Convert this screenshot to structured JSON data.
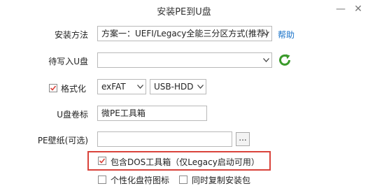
{
  "window": {
    "title": "安装PE到U盘",
    "minimize_glyph": "—",
    "close_glyph": "✕"
  },
  "install_method": {
    "label": "安装方法",
    "value": "方案一：UEFI/Legacy全能三分区方式(推荐)",
    "help_link": "帮助"
  },
  "target_disk": {
    "label": "待写入U盘",
    "value": "",
    "refresh_icon": "refresh-icon"
  },
  "format": {
    "label": "格式化",
    "checked": true,
    "filesystem": "exFAT",
    "mode": "USB-HDD"
  },
  "volume_label": {
    "label": "U盘卷标",
    "value": "微PE工具箱"
  },
  "wallpaper": {
    "label": "PE壁纸(可选)",
    "value": "",
    "browse_label": "..."
  },
  "include_dos": {
    "label": "包含DOS工具箱（仅Legacy启动可用）",
    "checked": true
  },
  "bottom_options": {
    "personalize_label": "个性化盘符图标",
    "copy_label": "同时复制安装包"
  },
  "colors": {
    "highlight": "#d9433b",
    "link": "#1a73c9",
    "refresh": "#3a9a2a"
  }
}
